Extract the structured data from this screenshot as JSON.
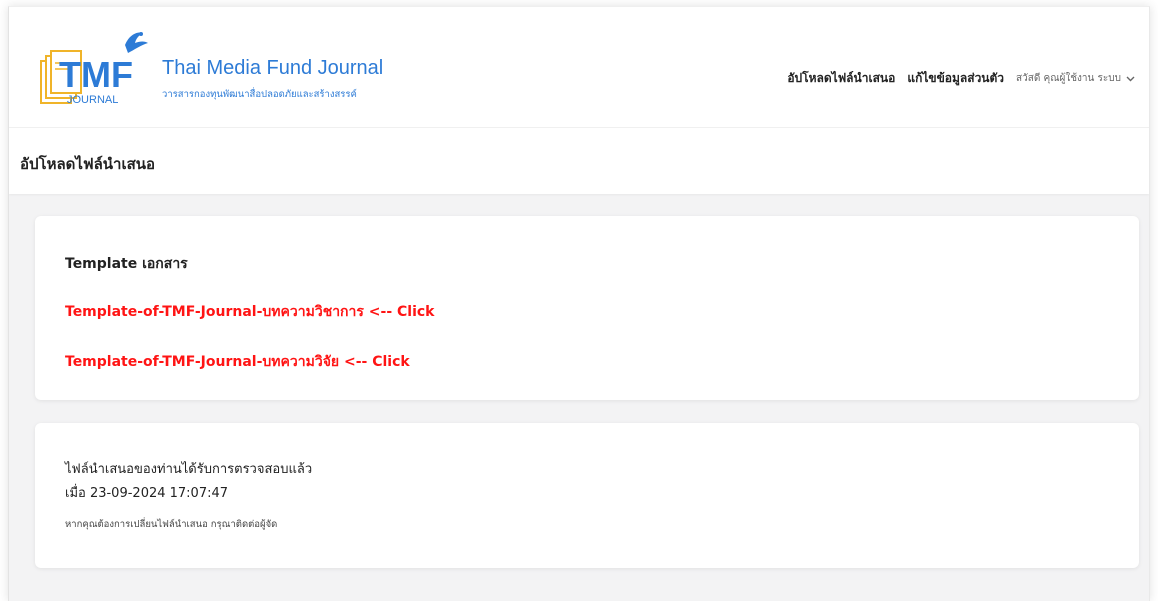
{
  "header": {
    "logo_letters": "TMF",
    "logo_journal": "JOURNAL",
    "logo_title": "Thai Media Fund Journal",
    "logo_subtitle": "วารสารกองทุนพัฒนาสื่อปลอดภัยและสร้างสรรค์"
  },
  "nav": {
    "upload": "อัปโหลดไฟล์นำเสนอ",
    "edit_profile": "แก้ไขข้อมูลส่วนตัว",
    "user_greeting": "สวัสดี คุณผู้ใช้งาน ระบบ"
  },
  "page": {
    "title": "อัปโหลดไฟล์นำเสนอ"
  },
  "templates": {
    "title": "Template เอกสาร",
    "links": [
      "Template-of-TMF-Journal-บทความวิชาการ <-- Click",
      "Template-of-TMF-Journal-บทความวิจัย <-- Click"
    ]
  },
  "status": {
    "line1": "ไฟล์นำเสนอของท่านได้รับการตรวจสอบแล้ว",
    "line2": "เมื่อ 23-09-2024 17:07:47",
    "note": "หากคุณต้องการเปลี่ยนไฟล์นำเสนอ กรุณาติดต่อผู้จัด"
  },
  "colors": {
    "brand_blue": "#2d7bd6",
    "logo_gold": "#f0b429",
    "link_red": "#ff1414"
  },
  "icons": {
    "logo": "bird-logo",
    "user_menu": "chevron-down-icon"
  }
}
